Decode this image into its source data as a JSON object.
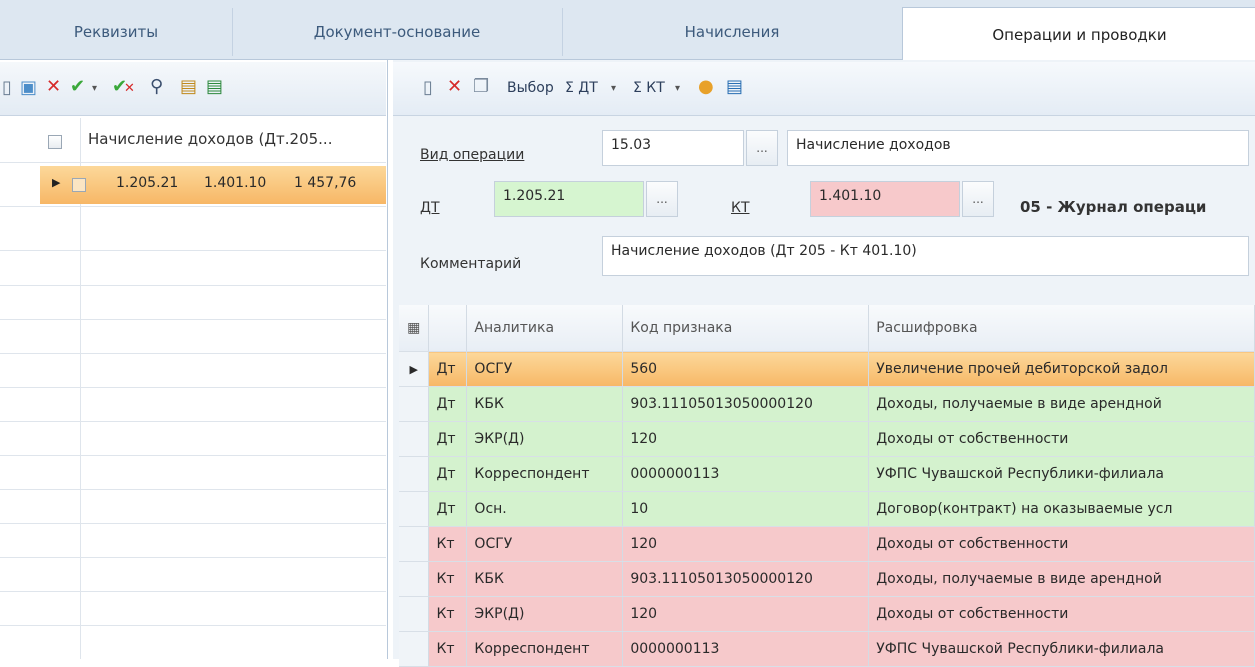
{
  "tabs": [
    "Реквизиты",
    "Документ-основание",
    "Начисления",
    "Операции и проводки"
  ],
  "left_grid": {
    "header": "Начисление доходов (Дт.205...",
    "row": {
      "dt": "1.205.21",
      "kt": "1.401.10",
      "sum": "1 457,76"
    }
  },
  "right_toolbar": {
    "select_label": "Выбор",
    "sum_dt_label": "Σ ДТ",
    "sum_kt_label": "Σ КТ"
  },
  "form": {
    "operation_type_label": "Вид операции",
    "operation_code": "15.03",
    "operation_name": "Начисление доходов",
    "dt_label": "ДТ",
    "dt_value": "1.205.21",
    "kt_label": "КТ",
    "kt_value": "1.401.10",
    "journal": "05 - Журнал операци",
    "comment_label": "Комментарий",
    "comment_value": "Начисление доходов (Дт 205 - Кт 401.10)",
    "browse_button": "..."
  },
  "analytics": {
    "headers": [
      "Аналитика",
      "Код признака",
      "Расшифровка"
    ],
    "rows": [
      {
        "side": "Дт",
        "name": "ОСГУ",
        "code": "560",
        "desc": "Увеличение прочей дебиторской задол"
      },
      {
        "side": "Дт",
        "name": "КБК",
        "code": "903.11105013050000120",
        "desc": "Доходы, получаемые в виде арендной"
      },
      {
        "side": "Дт",
        "name": "ЭКР(Д)",
        "code": "120",
        "desc": "Доходы от собственности"
      },
      {
        "side": "Дт",
        "name": "Корреспондент",
        "code": "0000000113",
        "desc": "УФПС Чувашской Республики-филиала"
      },
      {
        "side": "Дт",
        "name": "Осн.",
        "code": "10",
        "desc": "Договор(контракт) на оказываемые усл"
      },
      {
        "side": "Кт",
        "name": "ОСГУ",
        "code": "120",
        "desc": "Доходы от собственности"
      },
      {
        "side": "Кт",
        "name": "КБК",
        "code": "903.11105013050000120",
        "desc": "Доходы, получаемые в виде арендной"
      },
      {
        "side": "Кт",
        "name": "ЭКР(Д)",
        "code": "120",
        "desc": "Доходы от собственности"
      },
      {
        "side": "Кт",
        "name": "Корреспондент",
        "code": "0000000113",
        "desc": "УФПС Чувашской Республики-филиала"
      }
    ]
  },
  "colors": {
    "dt_row": "#d4f2ce",
    "kt_row": "#f6c9cb",
    "selected_row": "#f7b766"
  }
}
